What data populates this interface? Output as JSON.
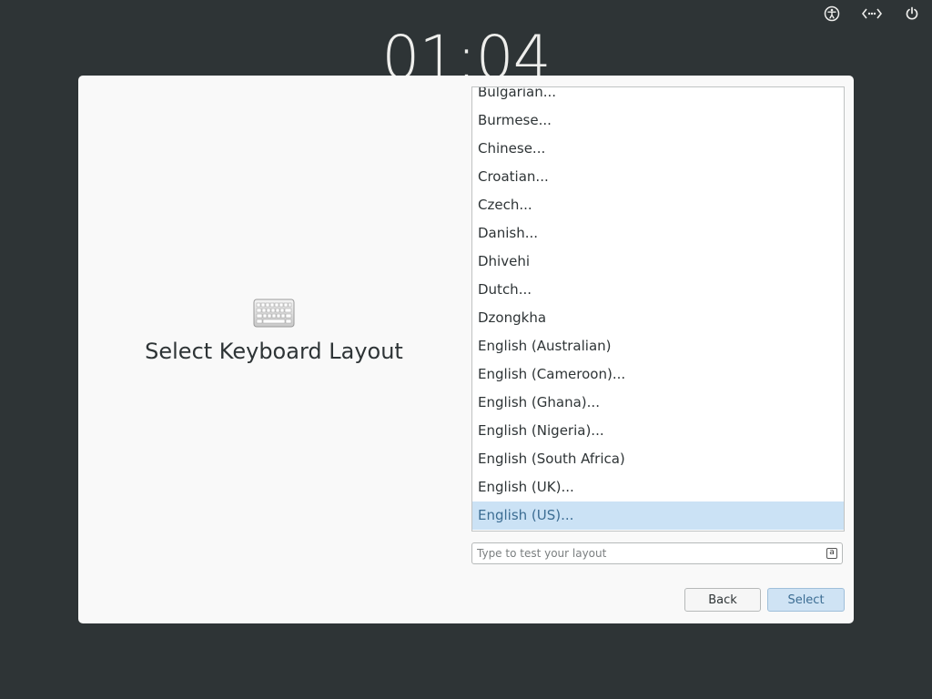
{
  "topbar": {
    "icons": [
      "accessibility-icon",
      "network-icon",
      "power-icon"
    ],
    "clock": "01:04"
  },
  "dialog": {
    "title": "Select Keyboard Layout",
    "icon": "keyboard-icon",
    "layouts": [
      "Bulgarian...",
      "Burmese...",
      "Chinese...",
      "Croatian...",
      "Czech...",
      "Danish...",
      "Dhivehi",
      "Dutch...",
      "Dzongkha",
      "English (Australian)",
      "English (Cameroon)...",
      "English (Ghana)...",
      "English (Nigeria)...",
      "English (South Africa)",
      "English (UK)...",
      "English (US)..."
    ],
    "selected_index": 15,
    "test_input": {
      "placeholder": "Type to test your layout",
      "value": "",
      "icon": "input-source-icon",
      "icon_letter": "a"
    },
    "buttons": {
      "back": "Back",
      "select": "Select"
    }
  },
  "colors": {
    "background": "#2e3436",
    "dialog": "#f9f9f9",
    "selection": "#cbe2f5",
    "accent": "#3c6d93"
  }
}
